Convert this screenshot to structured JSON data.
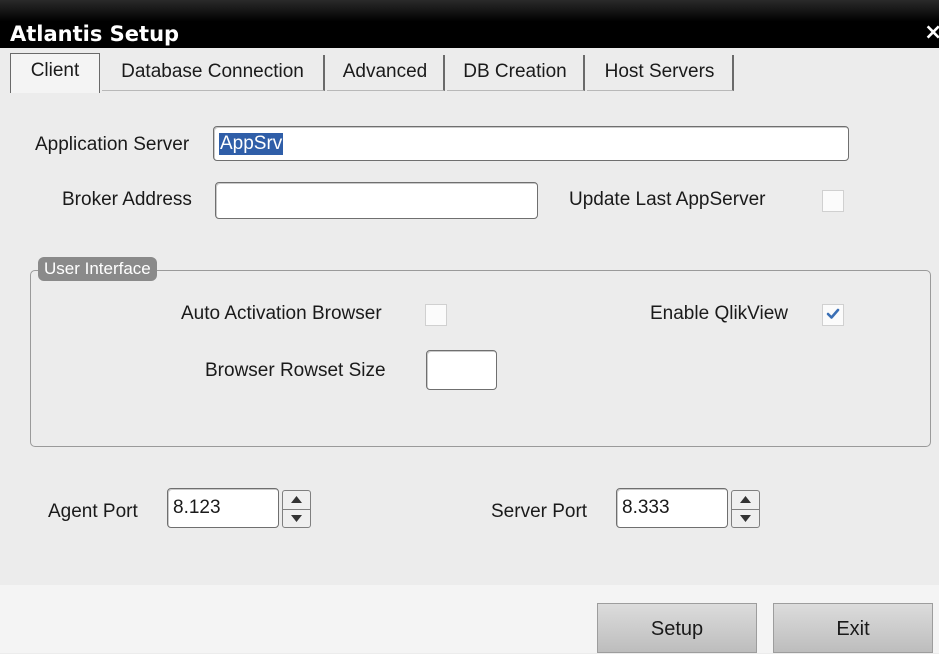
{
  "window": {
    "title": "Atlantis Setup",
    "close_icon": "close-icon",
    "close_glyph": "×"
  },
  "tabs": [
    {
      "label": "Client",
      "active": true
    },
    {
      "label": "Database Connection",
      "active": false
    },
    {
      "label": "Advanced",
      "active": false
    },
    {
      "label": "DB Creation",
      "active": false
    },
    {
      "label": "Host Servers",
      "active": false
    }
  ],
  "client": {
    "application_server": {
      "label": "Application Server",
      "value": "AppSrv"
    },
    "broker_address": {
      "label": "Broker Address",
      "value": ""
    },
    "update_last_appserver": {
      "label": "Update Last AppServer",
      "checked": false
    },
    "user_interface": {
      "legend": "User Interface",
      "auto_activation_browser": {
        "label": "Auto Activation Browser",
        "checked": false
      },
      "enable_qlikview": {
        "label": "Enable QlikView",
        "checked": true
      },
      "browser_rowset_size": {
        "label": "Browser Rowset Size",
        "value": ""
      }
    },
    "agent_port": {
      "label": "Agent Port",
      "value": "8.123"
    },
    "server_port": {
      "label": "Server Port",
      "value": "8.333"
    }
  },
  "buttons": {
    "setup_label": "Setup",
    "exit_label": "Exit"
  },
  "colors": {
    "titlebar": "#000000",
    "selection": "#2f5ea8",
    "check": "#3a6fb5"
  }
}
